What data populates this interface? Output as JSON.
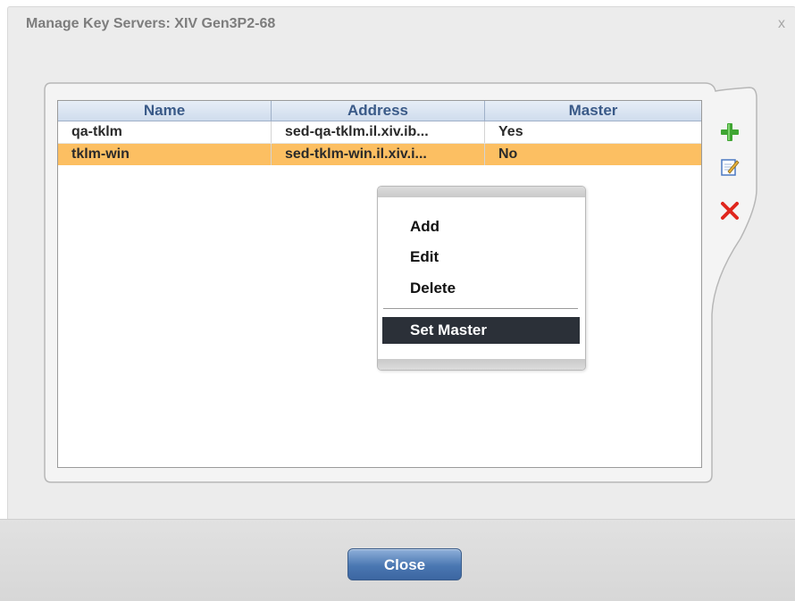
{
  "window": {
    "title": "Manage Key Servers: XIV Gen3P2-68",
    "close_glyph": "x"
  },
  "table": {
    "columns": [
      "Name",
      "Address",
      "Master"
    ],
    "rows": [
      {
        "name": "qa-tklm",
        "address": "sed-qa-tklm.il.xiv.ib...",
        "master": "Yes",
        "selected": false
      },
      {
        "name": "tklm-win",
        "address": "sed-tklm-win.il.xiv.i...",
        "master": "No",
        "selected": true
      }
    ]
  },
  "side_actions": [
    {
      "icon": "add-icon",
      "color": "#3fa532"
    },
    {
      "icon": "edit-icon",
      "color": "#4a78c2"
    },
    {
      "icon": "delete-icon",
      "color": "#e0261d"
    }
  ],
  "context_menu": {
    "items": [
      "Add",
      "Edit",
      "Delete"
    ],
    "highlighted": "Set Master"
  },
  "footer": {
    "close_label": "Close"
  },
  "colors": {
    "selected_row": "#fcbf62",
    "header_text": "#3a5a88",
    "button_blue": "#4a77b2"
  }
}
